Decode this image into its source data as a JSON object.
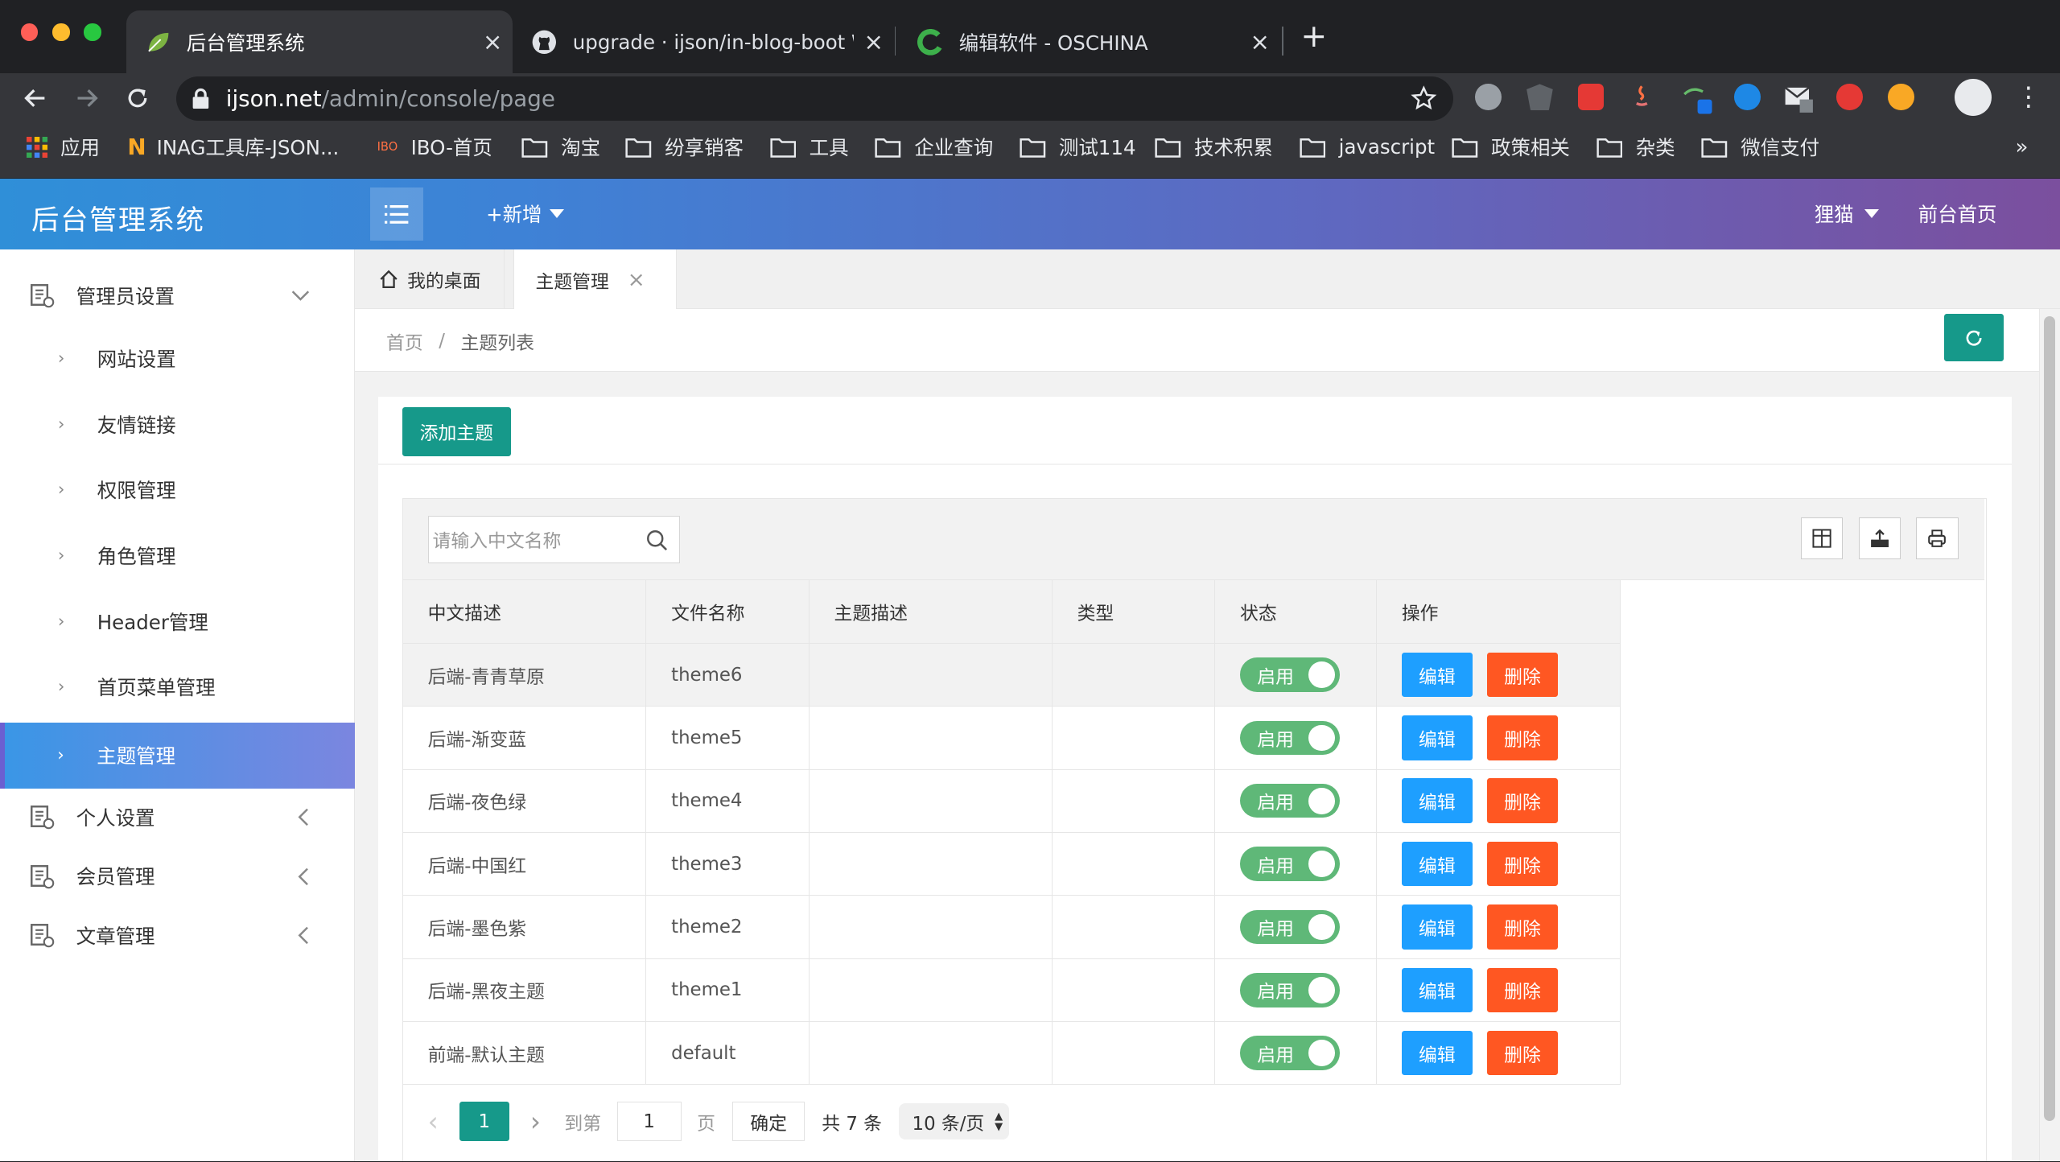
{
  "browser": {
    "tabs": [
      {
        "title": "后台管理系统",
        "active": true
      },
      {
        "title": "upgrade · ijson/in-blog-boot W",
        "active": false
      },
      {
        "title": "编辑软件 - OSCHINA",
        "active": false
      }
    ],
    "new_tab": "+",
    "url_host": "ijson.net",
    "url_path": "/admin/console/page",
    "bookmarks": [
      "应用",
      "INAG工具库-JSON...",
      "IBO-首页",
      "淘宝",
      "纷享销客",
      "工具",
      "企业查询",
      "测试114",
      "技术积累",
      "javascript",
      "政策相关",
      "杂类",
      "微信支付"
    ],
    "bookmarks_more": "»",
    "ibo_logo_text": "IBO"
  },
  "header": {
    "title": "后台管理系统",
    "add_label": "+新增",
    "user_label": "狸猫",
    "front_link": "前台首页"
  },
  "sidebar": {
    "group1": "管理员设置",
    "sub_items": [
      "网站设置",
      "友情链接",
      "权限管理",
      "角色管理",
      "Header管理",
      "首页菜单管理",
      "主题管理"
    ],
    "groups": [
      "个人设置",
      "会员管理",
      "文章管理"
    ]
  },
  "content_tabs": [
    {
      "label": "我的桌面",
      "active": false
    },
    {
      "label": "主题管理",
      "active": true
    }
  ],
  "breadcrumb": {
    "home": "首页",
    "sep": "/",
    "current": "主题列表"
  },
  "add_theme_button": "添加主题",
  "search": {
    "placeholder": "请输入中文名称"
  },
  "table": {
    "columns": [
      "中文描述",
      "文件名称",
      "主题描述",
      "类型",
      "状态",
      "操作"
    ],
    "rows": [
      {
        "name": "后端-青青草原",
        "file": "theme6",
        "desc": "",
        "type": "",
        "status": "启用"
      },
      {
        "name": "后端-渐变蓝",
        "file": "theme5",
        "desc": "",
        "type": "",
        "status": "启用"
      },
      {
        "name": "后端-夜色绿",
        "file": "theme4",
        "desc": "",
        "type": "",
        "status": "启用"
      },
      {
        "name": "后端-中国红",
        "file": "theme3",
        "desc": "",
        "type": "",
        "status": "启用"
      },
      {
        "name": "后端-墨色紫",
        "file": "theme2",
        "desc": "",
        "type": "",
        "status": "启用"
      },
      {
        "name": "后端-黑夜主题",
        "file": "theme1",
        "desc": "",
        "type": "",
        "status": "启用"
      },
      {
        "name": "前端-默认主题",
        "file": "default",
        "desc": "",
        "type": "",
        "status": "启用"
      }
    ],
    "edit_label": "编辑",
    "delete_label": "删除"
  },
  "pagination": {
    "prev": "‹",
    "current_page": "1",
    "next": "›",
    "goto_label": "到第",
    "goto_value": "1",
    "page_unit": "页",
    "confirm": "确定",
    "total": "共 7 条",
    "page_size": "10 条/页"
  },
  "colors": {
    "accent": "#16998a",
    "blue": "#1e9fff",
    "red": "#ff5722",
    "switch_on": "#5fb878"
  }
}
